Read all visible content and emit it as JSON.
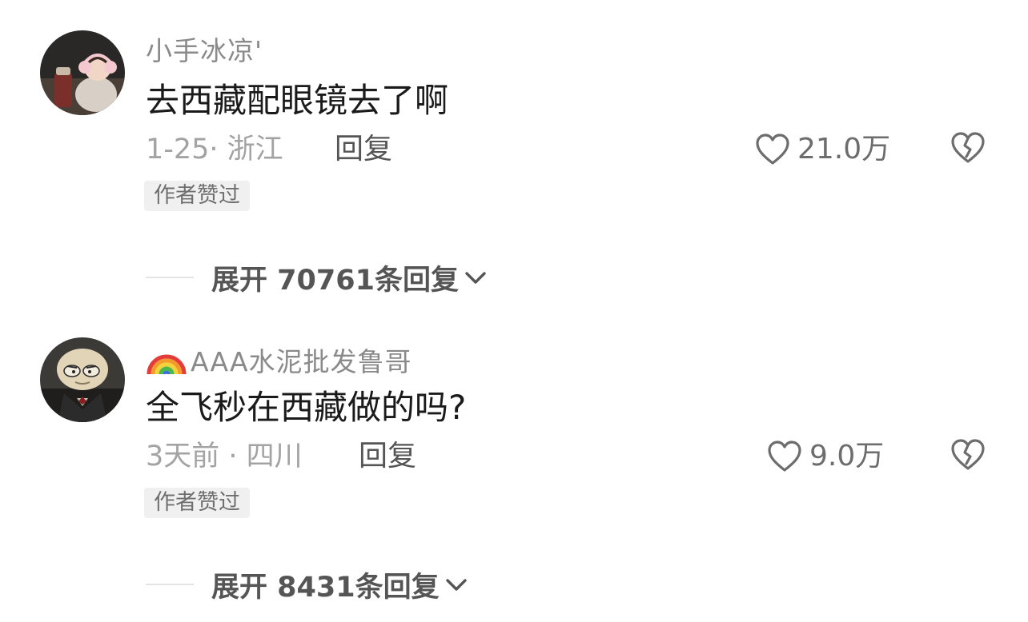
{
  "comments": [
    {
      "username": "小手冰凉'",
      "text": "去西藏配眼镜去了啊",
      "meta": "1-25· 浙江",
      "reply_label": "回复",
      "likes": "21.0万",
      "badge": "作者赞过",
      "expand_label": "展开 70761条回复"
    },
    {
      "username": "AAA水泥批发鲁哥",
      "text": "全飞秒在西藏做的吗?",
      "meta": "3天前 · 四川",
      "reply_label": "回复",
      "likes": "9.0万",
      "badge": "作者赞过",
      "expand_label": "展开 8431条回复"
    }
  ],
  "icons": {
    "like": "heart-outline-icon",
    "dislike": "broken-heart-icon",
    "expand": "chevron-down-icon",
    "username_prefix": "rainbow-emoji-icon"
  },
  "colors": {
    "username": "#8a8a8a",
    "text": "#1a1a1a",
    "meta": "#a3a3a3",
    "badge_bg": "#f0f0f0"
  }
}
